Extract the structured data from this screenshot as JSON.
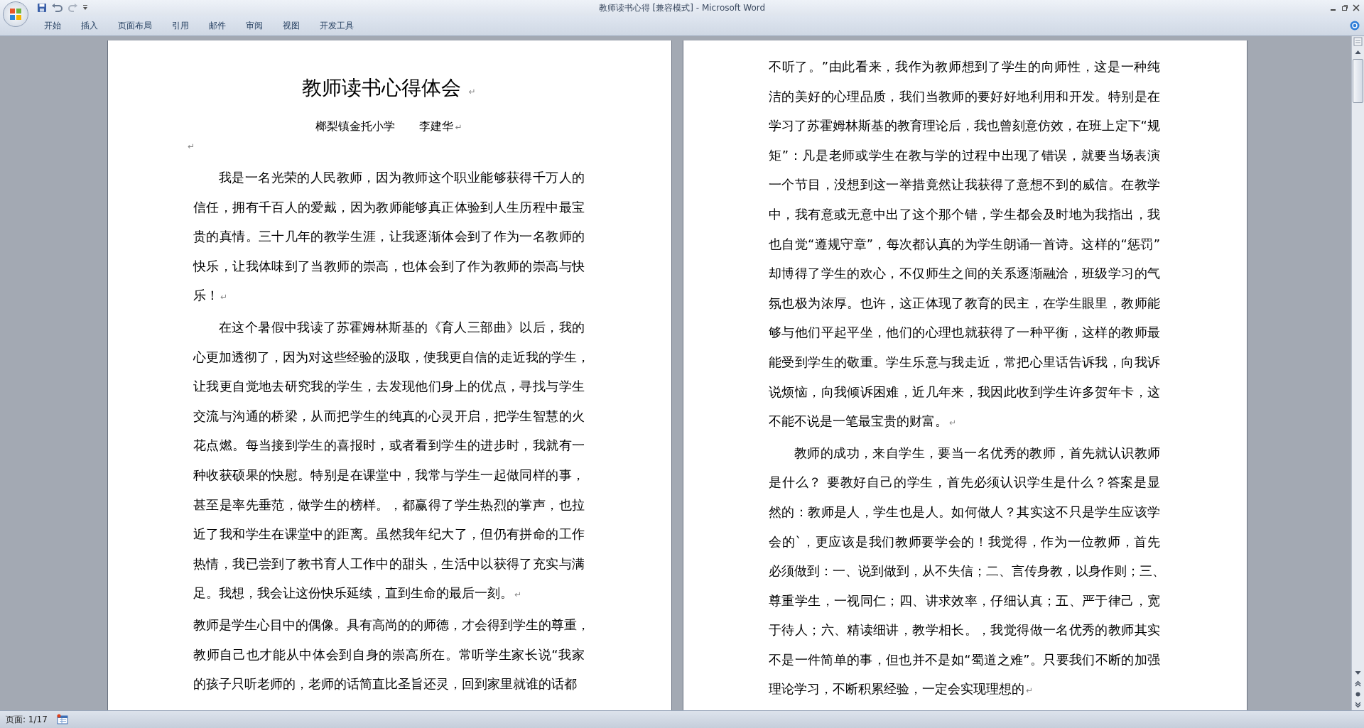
{
  "window": {
    "title": "教师读书心得 [兼容模式] - Microsoft Word"
  },
  "ribbon_tabs": [
    {
      "label": "开始"
    },
    {
      "label": "插入"
    },
    {
      "label": "页面布局"
    },
    {
      "label": "引用"
    },
    {
      "label": "邮件"
    },
    {
      "label": "审阅"
    },
    {
      "label": "视图"
    },
    {
      "label": "开发工具"
    }
  ],
  "pages": [
    {
      "paragraphs": [
        {
          "kind": "title",
          "text": "教师读书心得体会",
          "end_mark": "↵"
        },
        {
          "kind": "byline",
          "parts": [
            "榔梨镇金托小学",
            "李建华"
          ],
          "end_mark": "↵"
        },
        {
          "kind": "empty",
          "end_mark": "↵"
        },
        {
          "kind": "body",
          "indent": true,
          "end_mark": "↵",
          "lines": [
            "我是一名光荣的人民教师，因为教师这个职业能够获得千万人的",
            "信任，拥有千百人的爱戴，因为教师能够真正体验到人生历程中最宝",
            "贵的真情。三十几年的教学生涯，让我逐渐体会到了作为一名教师的",
            "快乐，让我体味到了当教师的崇高，也体会到了作为教师的崇高与快",
            "乐！"
          ]
        },
        {
          "kind": "body",
          "indent": true,
          "end_mark": "↵",
          "lines": [
            "在这个暑假中我读了苏霍姆林斯基的《育人三部曲》以后，我的",
            "心更加透彻了，因为对这些经验的汲取，使我更自信的走近我的学生，",
            "让我更自觉地去研究我的学生，去发现他们身上的优点，寻找与学生",
            "交流与沟通的桥梁，从而把学生的纯真的心灵开启，把学生智慧的火",
            "花点燃。每当接到学生的喜报时，或者看到学生的进步时，我就有一",
            "种收获硕果的快慰。特别是在课堂中，我常与学生一起做同样的事，",
            "甚至是率先垂范，做学生的榜样。，都赢得了学生热烈的掌声，也拉",
            "近了我和学生在课堂中的距离。虽然我年纪大了，但仍有拼命的工作",
            "热情，我已尝到了教书育人工作中的甜头，生活中以获得了充实与满",
            "足。我想，我会让这份快乐延续，直到生命的最后一刻。"
          ]
        },
        {
          "kind": "body",
          "indent": false,
          "lines": [
            "教师是学生心目中的偶像。具有高尚的的师德，才会得到学生的尊重，",
            "教师自己也才能从中体会到自身的崇高所在。常听学生家长说“我家",
            "的孩子只听老师的，老师的话简直比圣旨还灵，回到家里就谁的话都"
          ]
        }
      ]
    },
    {
      "paragraphs": [
        {
          "kind": "body",
          "indent": false,
          "end_mark": "↵",
          "lines": [
            "不听了。”由此看来，我作为教师想到了学生的向师性，这是一种纯",
            "洁的美好的心理品质，我们当教师的要好好地利用和开发。特别是在",
            "学习了苏霍姆林斯基的教育理论后，我也曾刻意仿效，在班上定下“规",
            "矩”：凡是老师或学生在教与学的过程中出现了错误，就要当场表演",
            "一个节目，没想到这一举措竟然让我获得了意想不到的威信。在教学",
            "中，我有意或无意中出了这个那个错，学生都会及时地为我指出，我",
            "也自觉“遵规守章”，每次都认真的为学生朗诵一首诗。这样的“惩罚”",
            "却博得了学生的欢心，不仅师生之间的关系逐渐融洽，班级学习的气",
            "氛也极为浓厚。也许，这正体现了教育的民主，在学生眼里，教师能",
            "够与他们平起平坐，他们的心理也就获得了一种平衡，这样的教师最",
            "能受到学生的敬重。学生乐意与我走近，常把心里话告诉我，向我诉",
            "说烦恼，向我倾诉困难，近几年来，我因此收到学生许多贺年卡，这",
            "不能不说是一笔最宝贵的财富。"
          ]
        },
        {
          "kind": "body",
          "indent": true,
          "end_mark": "↵",
          "lines": [
            "教师的成功，来自学生，要当一名优秀的教师，首先就认识教师",
            "是什么？ 要教好自己的学生，首先必须认识学生是什么？答案是显",
            "然的：教师是人，学生也是人。如何做人？其实这不只是学生应该学",
            "会的`，更应该是我们教师要学会的！我觉得，作为一位教师，首先",
            "必须做到：一、说到做到，从不失信；二、言传身教，以身作则；三、",
            "尊重学生，一视同仁；四、讲求效率，仔细认真；五、严于律己，宽",
            "于待人；六、精读细讲，教学相长。，我觉得做一名优秀的教师其实",
            "不是一件简单的事，但也并不是如“蜀道之难”。只要我们不断的加强",
            "理论学习，不断积累经验，一定会实现理想的"
          ]
        }
      ]
    }
  ],
  "status_bar": {
    "page_info": "页面: 1/17"
  }
}
